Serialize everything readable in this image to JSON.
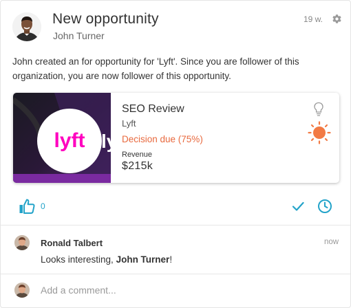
{
  "post": {
    "title": "New opportunity",
    "author": "John Turner",
    "timestamp": "19 w.",
    "description": "John created an for opportunity for 'Lyft'. Since you are follower of this organization, you are now follower of this opportunity."
  },
  "opportunity": {
    "image_text_main": "lyft",
    "image_text_side": "lyft",
    "title": "SEO Review",
    "company": "Lyft",
    "status": "Decision due (75%)",
    "revenue_label": "Revenue",
    "revenue": "$215k",
    "brand_color": "#ff00bf",
    "status_color": "#e8693e"
  },
  "actions": {
    "like_count": "0",
    "accent_color": "#23a3c9",
    "icons": [
      "thumbs-up-icon",
      "check-icon",
      "clock-icon",
      "gear-icon",
      "lightbulb-icon",
      "sun-icon"
    ]
  },
  "comment": {
    "author": "Ronald Talbert",
    "time": "now",
    "text_prefix": "Looks interesting, ",
    "mention": "John Turner",
    "text_suffix": "!"
  },
  "composer": {
    "placeholder": "Add a comment..."
  }
}
